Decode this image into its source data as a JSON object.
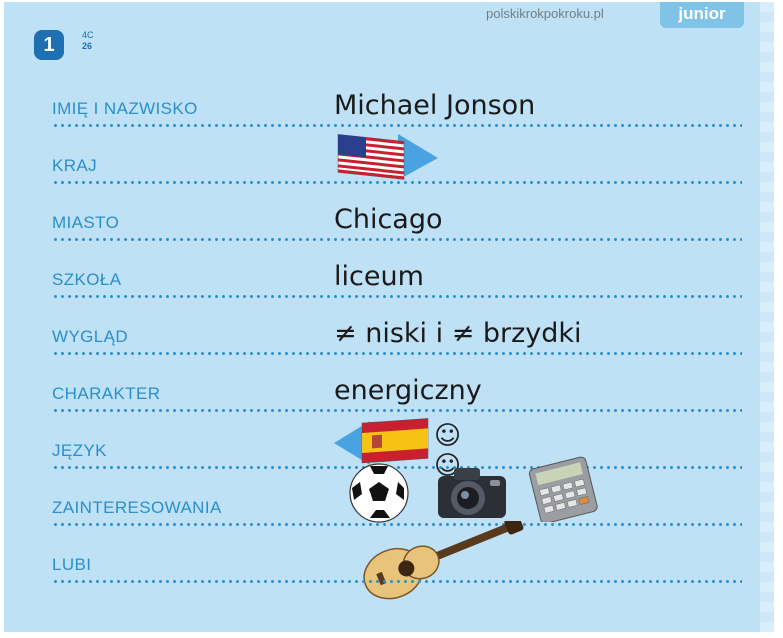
{
  "header": {
    "site": "polskikrokpokroku.pl",
    "brand": "junior",
    "lesson_number": "1",
    "code_top": "4C",
    "code_bottom": "26"
  },
  "rows": [
    {
      "label": "IMIĘ I NAZWISKO",
      "value": "Michael Jonson"
    },
    {
      "label": "KRAJ",
      "value": "",
      "icon": "usa-flag-icon"
    },
    {
      "label": "MIASTO",
      "value": "Chicago"
    },
    {
      "label": "SZKOŁA",
      "value": "liceum"
    },
    {
      "label": "WYGLĄD",
      "value": "≠ niski i ≠ brzydki"
    },
    {
      "label": "CHARAKTER",
      "value": "energiczny"
    },
    {
      "label": "JĘZYK",
      "value": "☺☺",
      "icon": "spain-flag-icon"
    },
    {
      "label": "ZAINTERESOWANIA",
      "value": "",
      "icons": [
        "football-icon",
        "camera-icon",
        "calculator-icon"
      ]
    },
    {
      "label": "LUBI",
      "value": "",
      "icon": "guitar-icon"
    }
  ],
  "colors": {
    "background": "#bfe1f6",
    "label": "#2a8fca",
    "value": "#1a1a1a",
    "badge": "#1f6fb3",
    "brand_tab": "#7fc4e6"
  }
}
